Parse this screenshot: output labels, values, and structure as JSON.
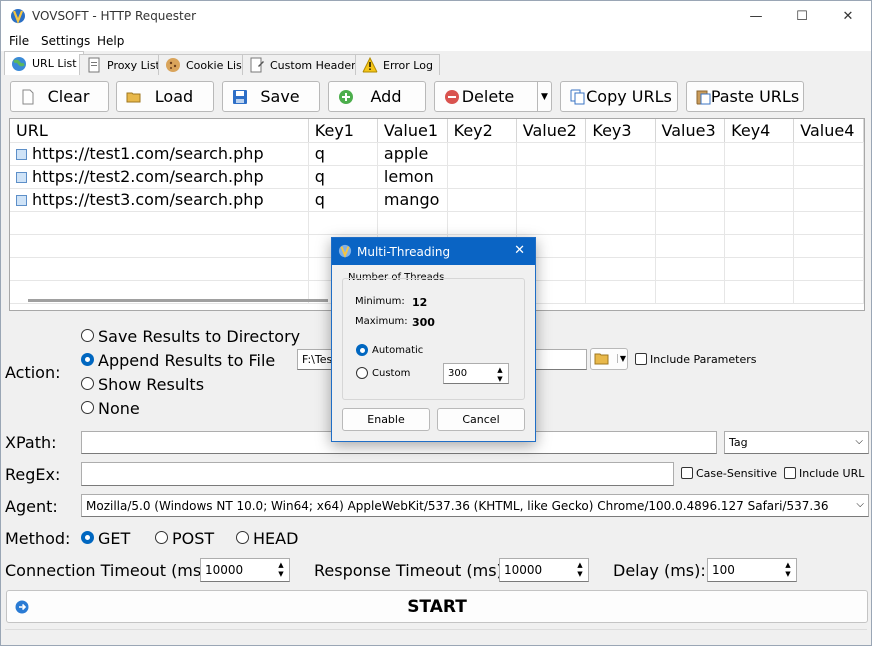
{
  "window": {
    "title": "VOVSOFT - HTTP Requester",
    "minimize": "—",
    "maximize": "☐",
    "close": "✕"
  },
  "menu": [
    "File",
    "Settings",
    "Help"
  ],
  "tabs": [
    "URL List",
    "Proxy List",
    "Cookie List",
    "Custom Headers",
    "Error Log"
  ],
  "toolbar": {
    "clear": "Clear",
    "load": "Load",
    "save": "Save",
    "add": "Add",
    "delete": "Delete",
    "copy_urls": "Copy URLs",
    "paste_urls": "Paste URLs"
  },
  "grid": {
    "columns": [
      "URL",
      "Key1",
      "Value1",
      "Key2",
      "Value2",
      "Key3",
      "Value3",
      "Key4",
      "Value4"
    ],
    "rows": [
      [
        "https://test1.com/search.php",
        "q",
        "apple",
        "",
        "",
        "",
        "",
        "",
        ""
      ],
      [
        "https://test2.com/search.php",
        "q",
        "lemon",
        "",
        "",
        "",
        "",
        "",
        ""
      ],
      [
        "https://test3.com/search.php",
        "q",
        "mango",
        "",
        "",
        "",
        "",
        "",
        ""
      ]
    ]
  },
  "action": {
    "label": "Action:",
    "options": [
      "Save Results to Directory",
      "Append Results to File",
      "Show Results",
      "None"
    ],
    "selected": 1,
    "path_value": "F:\\Test",
    "include_parameters": "Include Parameters"
  },
  "xpath": {
    "label": "XPath:",
    "value": "",
    "tag_select": "Tag"
  },
  "regex": {
    "label": "RegEx:",
    "value": "",
    "case_sensitive": "Case-Sensitive",
    "include_url": "Include URL"
  },
  "agent": {
    "label": "Agent:",
    "value": "Mozilla/5.0 (Windows NT 10.0; Win64; x64) AppleWebKit/537.36 (KHTML, like Gecko) Chrome/100.0.4896.127 Safari/537.36"
  },
  "method": {
    "label": "Method:",
    "options": [
      "GET",
      "POST",
      "HEAD"
    ],
    "selected": 0
  },
  "timeouts": {
    "connection_label": "Connection Timeout (ms):",
    "connection_value": "10000",
    "response_label": "Response Timeout (ms):",
    "response_value": "10000",
    "delay_label": "Delay (ms):",
    "delay_value": "100"
  },
  "start": {
    "label": "START"
  },
  "dialog": {
    "title": "Multi-Threading",
    "group_label": "Number of Threads",
    "minimum_label": "Minimum:",
    "minimum_value": "12",
    "maximum_label": "Maximum:",
    "maximum_value": "300",
    "automatic": "Automatic",
    "custom": "Custom",
    "custom_value": "300",
    "enable": "Enable",
    "cancel": "Cancel"
  },
  "colors": {
    "accent": "#0067c0",
    "dialog_title": "#0a64c4"
  }
}
